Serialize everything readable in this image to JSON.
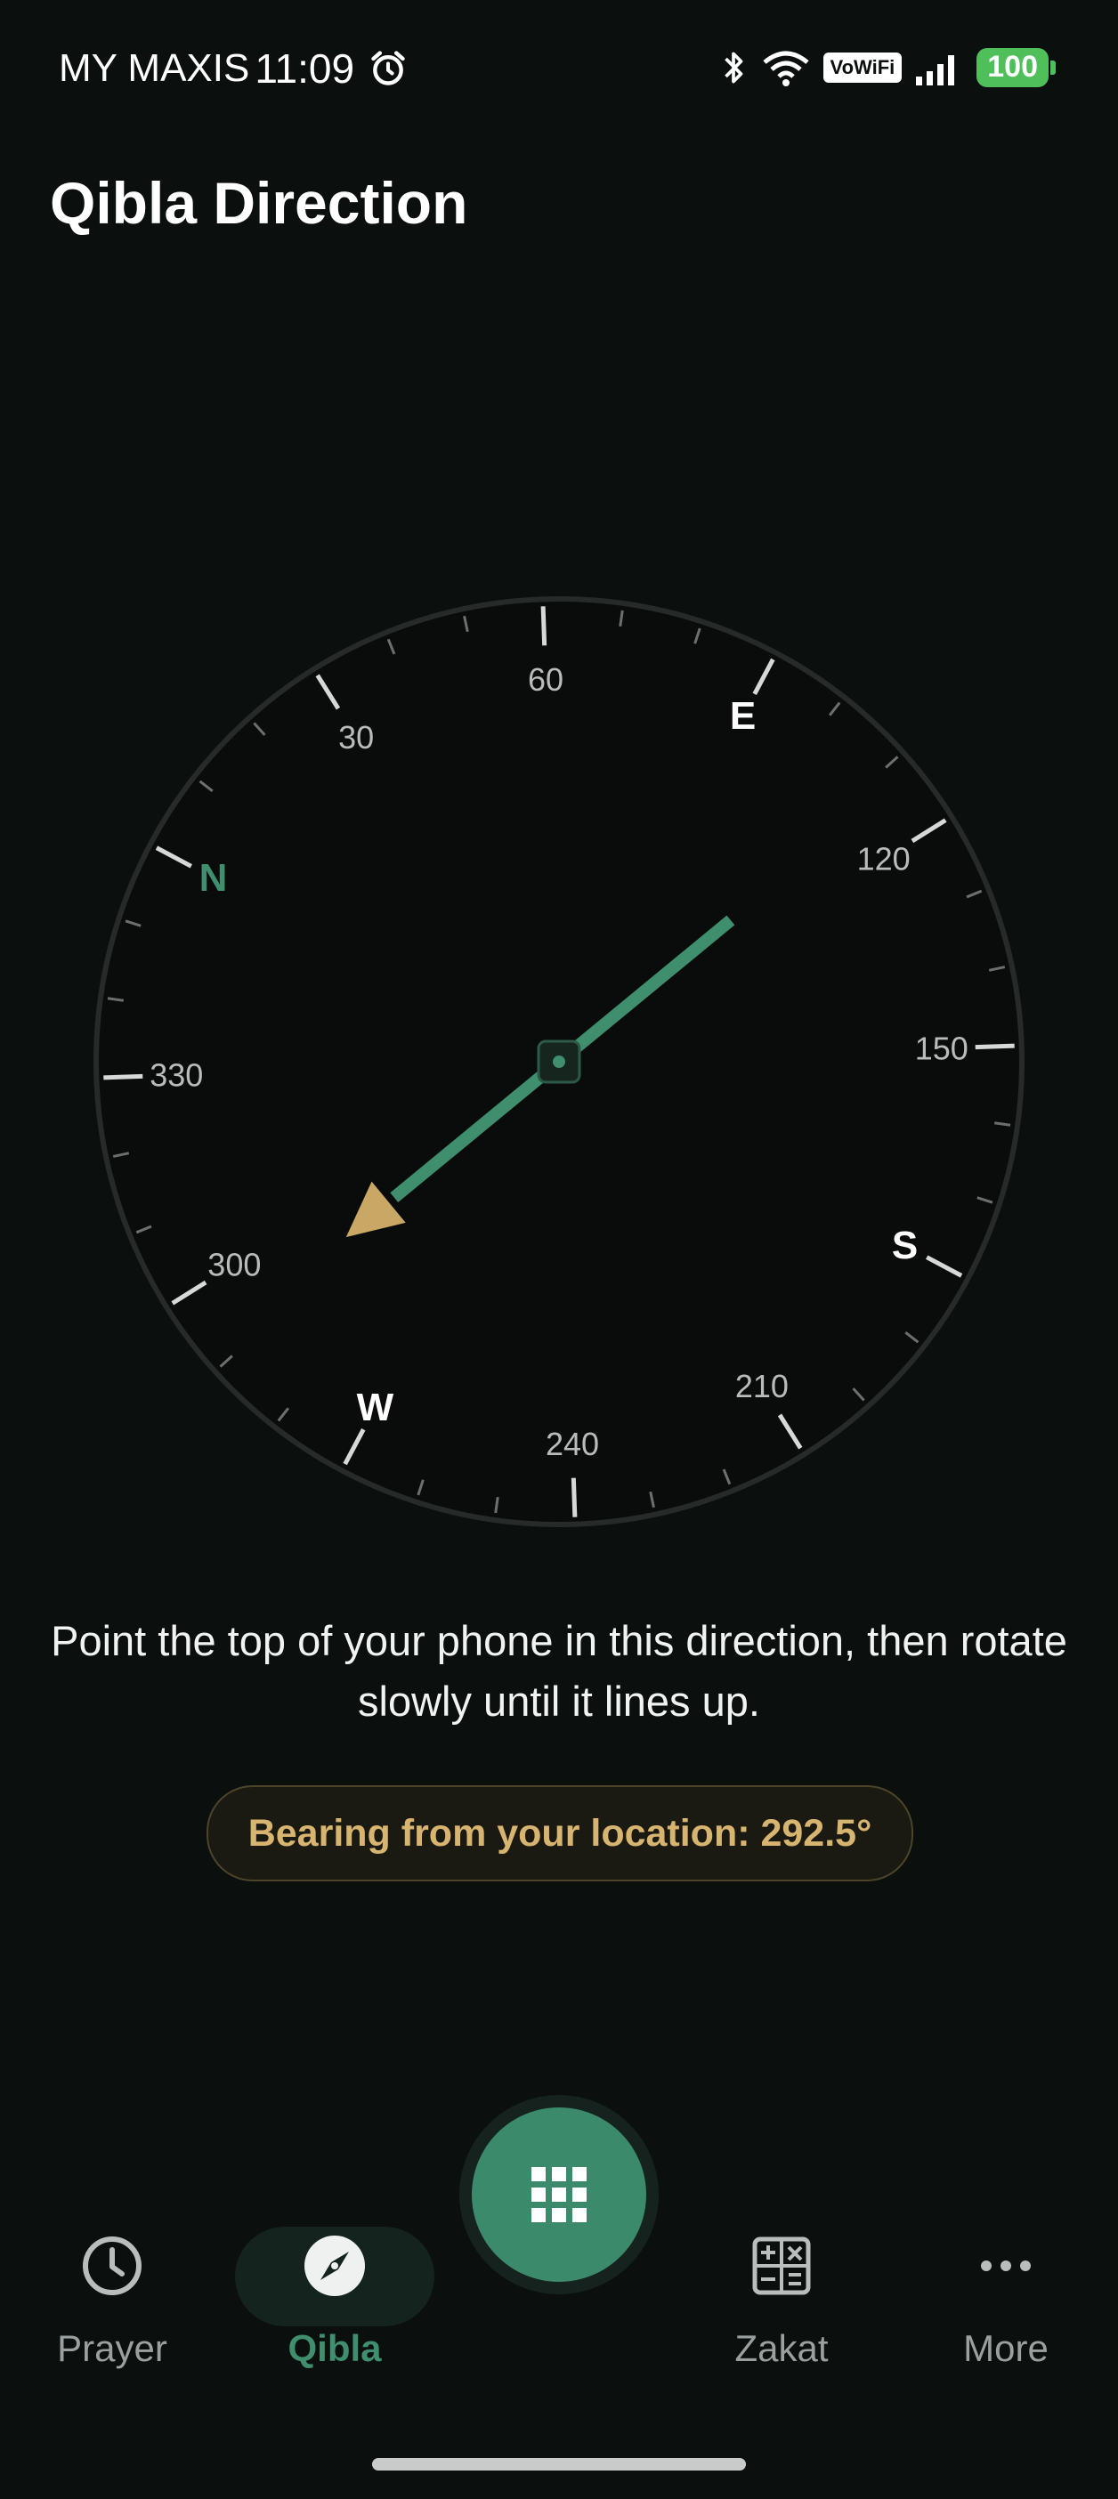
{
  "status_bar": {
    "carrier": "MY MAXIS",
    "time": "11:09",
    "volte_badge": "VoWiFi",
    "battery": "100",
    "icons": [
      "alarm-icon",
      "bluetooth-icon",
      "wifi-icon",
      "volte-icon",
      "signal-icon",
      "battery-icon"
    ]
  },
  "header": {
    "title": "Qibla Direction"
  },
  "compass": {
    "heading_deg": 62,
    "qibla_bearing_deg": 292.5,
    "cardinals": {
      "n": "N",
      "e": "E",
      "s": "S",
      "w": "W"
    },
    "degree_labels": [
      "30",
      "60",
      "120",
      "150",
      "210",
      "240",
      "300",
      "330"
    ],
    "colors": {
      "north": "#3f8e6d",
      "needle": "#3f8e6d",
      "arrow_head": "#c9a865",
      "ring": "#262a29"
    }
  },
  "instruction": "Point the top of your phone in this direction, then rotate slowly until it lines up.",
  "bearing": {
    "label": "Bearing from your location: 292.5°"
  },
  "nav": {
    "items": [
      {
        "label": "Prayer",
        "icon": "clock-icon"
      },
      {
        "label": "Qibla",
        "icon": "compass-icon",
        "active": true
      },
      {
        "label": "Zakat",
        "icon": "calculator-icon"
      },
      {
        "label": "More",
        "icon": "more-dots-icon"
      }
    ],
    "fab_icon": "grid-icon",
    "accent": "#3c8a6c"
  }
}
